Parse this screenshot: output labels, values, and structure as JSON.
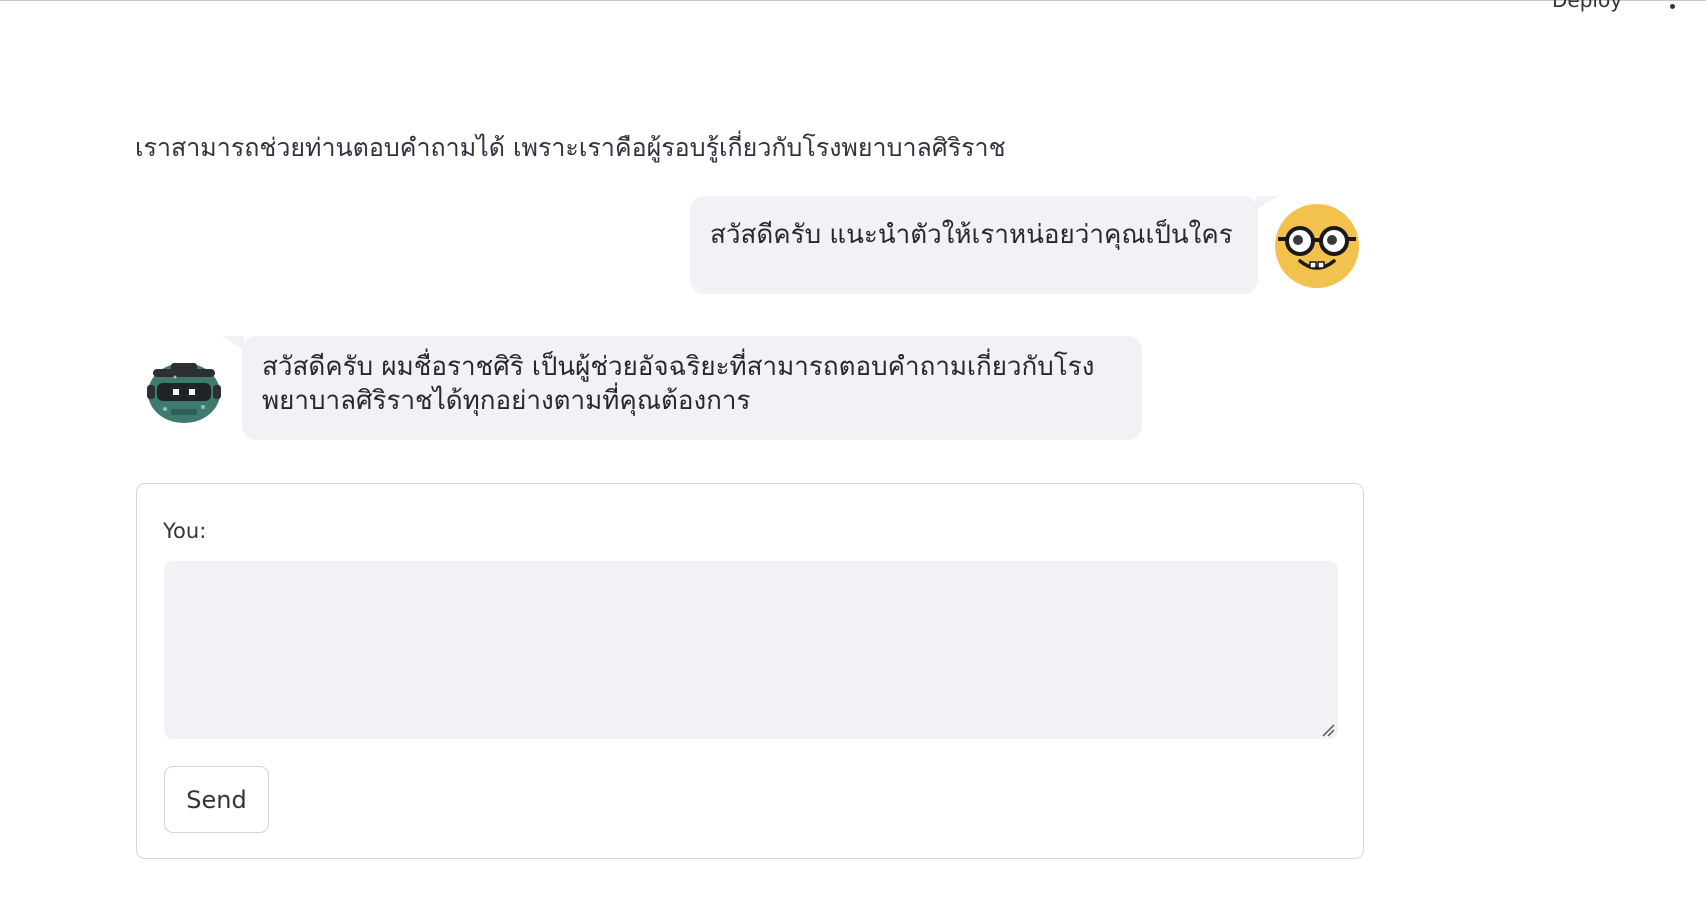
{
  "header": {
    "deploy_label": "Deploy",
    "menu_icon": "kebab-menu-icon"
  },
  "page": {
    "subtitle": "เราสามารถช่วยท่านตอบคำถามได้ เพราะเราคือผู้รอบรู้เกี่ยวกับโรงพยาบาลศิริราช"
  },
  "messages": [
    {
      "role": "user",
      "text": "สวัสดีครับ แนะนำตัวให้เราหน่อยว่าคุณเป็นใคร",
      "avatar": "nerd-face-emoji-icon"
    },
    {
      "role": "bot",
      "text": "สวัสดีครับ ผมชื่อราชศิริ เป็นผู้ช่วยอัจฉริยะที่สามารถตอบคำถามเกี่ยวกับโรงพยาบาลศิริราชได้ทุกอย่างตามที่คุณต้องการ",
      "avatar": "robot-avatar-icon"
    }
  ],
  "form": {
    "input_label": "You:",
    "input_value": "",
    "send_label": "Send"
  },
  "colors": {
    "bubble_bg": "#f0f2f6",
    "emoji_yellow": "#f2c14e",
    "robot_teal": "#3f7a6f"
  }
}
